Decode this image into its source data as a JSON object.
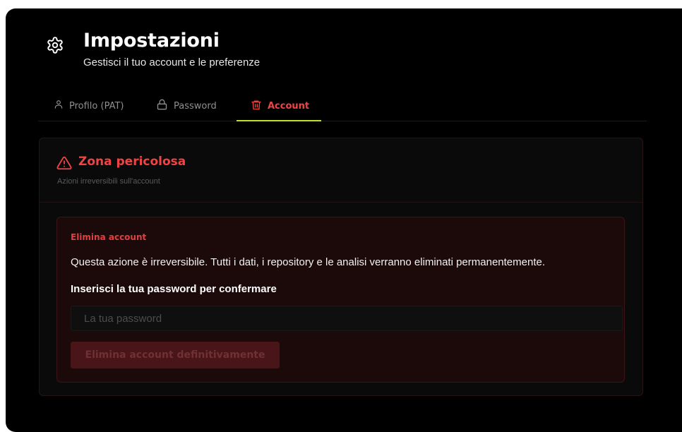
{
  "header": {
    "icon": "gear-icon",
    "title": "Impostazioni",
    "subtitle": "Gestisci il tuo account e le preferenze"
  },
  "tabs": [
    {
      "label": "Profilo (PAT)",
      "icon": "user-icon",
      "active": false
    },
    {
      "label": "Password",
      "icon": "lock-icon",
      "active": false
    },
    {
      "label": "Account",
      "icon": "trash-icon",
      "active": true
    }
  ],
  "danger_zone": {
    "icon": "warning-icon",
    "title": "Zona pericolosa",
    "subtitle": "Azioni irreversibili sull'account",
    "delete_account": {
      "title": "Elimina account",
      "description": "Questa azione è irreversibile. Tutti i dati, i repository e le analisi verranno eliminati permanentemente.",
      "password_label": "Inserisci la tua password per confermare",
      "password_placeholder": "La tua password",
      "password_value": "",
      "button_label": "Elimina account definitivamente",
      "button_disabled": true
    }
  },
  "colors": {
    "background": "#000000",
    "danger": "#f04444",
    "active_tab_underline": "#c6e02a",
    "tab_inactive": "#8f8f8f"
  }
}
